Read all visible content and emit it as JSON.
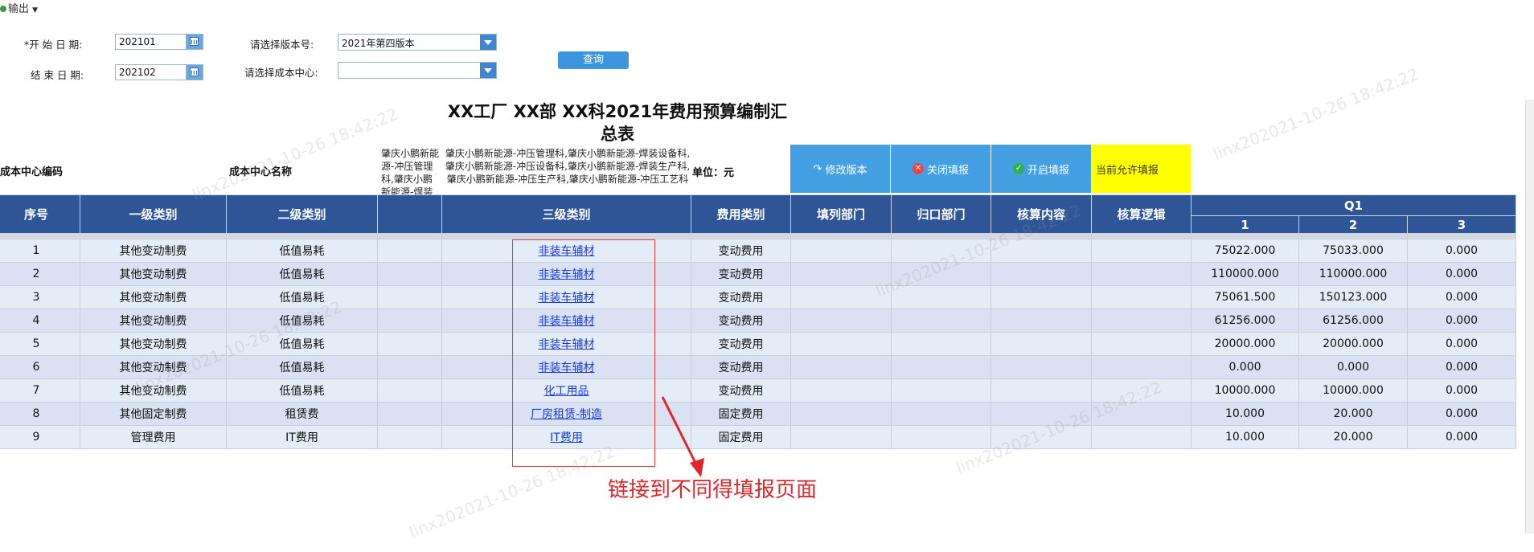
{
  "toolbar": {
    "export_label": "输出"
  },
  "filters": {
    "start_date_label": "*开 始 日 期:",
    "start_date_value": "202101",
    "end_date_label": "结 束 日 期:",
    "end_date_value": "202102",
    "version_label": "请选择版本号:",
    "version_value": "2021年第四版本",
    "cost_center_label": "请选择成本中心:",
    "cost_center_value": "",
    "query_button": "查询"
  },
  "report": {
    "title_line1": "XX工厂 XX部 XX科2021年费用预算编制汇",
    "title_line2": "总表",
    "cost_center_code_label": "成本中心编码",
    "cost_center_name_label": "成本中心名称",
    "description_left": "肇庆小鹏新能源-冲压管理科,肇庆小鹏新能源-焊装生产科,肇庆小鹏新能源-",
    "description_right": "肇庆小鹏新能源-冲压管理科,肇庆小鹏新能源-焊装设备科,肇庆小鹏新能源-冲压设备科,肇庆小鹏新能源-焊装生产科,肇庆小鹏新能源-冲压生产科,肇庆小鹏新能源-冲压工艺科",
    "unit_label": "单位：元"
  },
  "actions": {
    "modify_version": "修改版本",
    "close_fill": "关闭填报",
    "open_fill": "开启填报",
    "allow_fill": "当前允许填报"
  },
  "table": {
    "headers": {
      "seq": "序号",
      "level1": "一级类别",
      "level2": "二级类别",
      "blank": "",
      "level3": "三级类别",
      "expense_type": "费用类别",
      "fill_dept": "填列部门",
      "owner_dept": "归口部门",
      "calc_content": "核算内容",
      "calc_logic": "核算逻辑",
      "q1": "Q1",
      "m1": "1",
      "m2": "2",
      "m3": "3"
    },
    "rows": [
      {
        "seq": "1",
        "level1": "其他变动制费",
        "level2": "低值易耗",
        "level3": "非装车辅材",
        "type": "变动费用",
        "m1": "75022.000",
        "m2": "75033.000",
        "m3": "0.000"
      },
      {
        "seq": "2",
        "level1": "其他变动制费",
        "level2": "低值易耗",
        "level3": "非装车辅材",
        "type": "变动费用",
        "m1": "110000.000",
        "m2": "110000.000",
        "m3": "0.000"
      },
      {
        "seq": "3",
        "level1": "其他变动制费",
        "level2": "低值易耗",
        "level3": "非装车辅材",
        "type": "变动费用",
        "m1": "75061.500",
        "m2": "150123.000",
        "m3": "0.000"
      },
      {
        "seq": "4",
        "level1": "其他变动制费",
        "level2": "低值易耗",
        "level3": "非装车辅材",
        "type": "变动费用",
        "m1": "61256.000",
        "m2": "61256.000",
        "m3": "0.000"
      },
      {
        "seq": "5",
        "level1": "其他变动制费",
        "level2": "低值易耗",
        "level3": "非装车辅材",
        "type": "变动费用",
        "m1": "20000.000",
        "m2": "20000.000",
        "m3": "0.000"
      },
      {
        "seq": "6",
        "level1": "其他变动制费",
        "level2": "低值易耗",
        "level3": "非装车辅材",
        "type": "变动费用",
        "m1": "0.000",
        "m2": "0.000",
        "m3": "0.000"
      },
      {
        "seq": "7",
        "level1": "其他变动制费",
        "level2": "低值易耗",
        "level3": "化工用品",
        "type": "变动费用",
        "m1": "10000.000",
        "m2": "10000.000",
        "m3": "0.000"
      },
      {
        "seq": "8",
        "level1": "其他固定制费",
        "level2": "租赁费",
        "level3": "厂房租赁-制造",
        "type": "固定费用",
        "m1": "10.000",
        "m2": "20.000",
        "m3": "0.000"
      },
      {
        "seq": "9",
        "level1": "管理费用",
        "level2": "IT费用",
        "level3": "IT费用",
        "type": "固定费用",
        "m1": "10.000",
        "m2": "20.000",
        "m3": "0.000"
      }
    ]
  },
  "annotation": {
    "note": "链接到不同得填报页面"
  },
  "watermark": {
    "text": "linx202021-10-26 18:42:22"
  },
  "colors": {
    "header_bg": "#2f5597",
    "action_blue": "#45a0e3",
    "allow_yellow": "#ffff00",
    "annotation_red": "#e0262b"
  }
}
